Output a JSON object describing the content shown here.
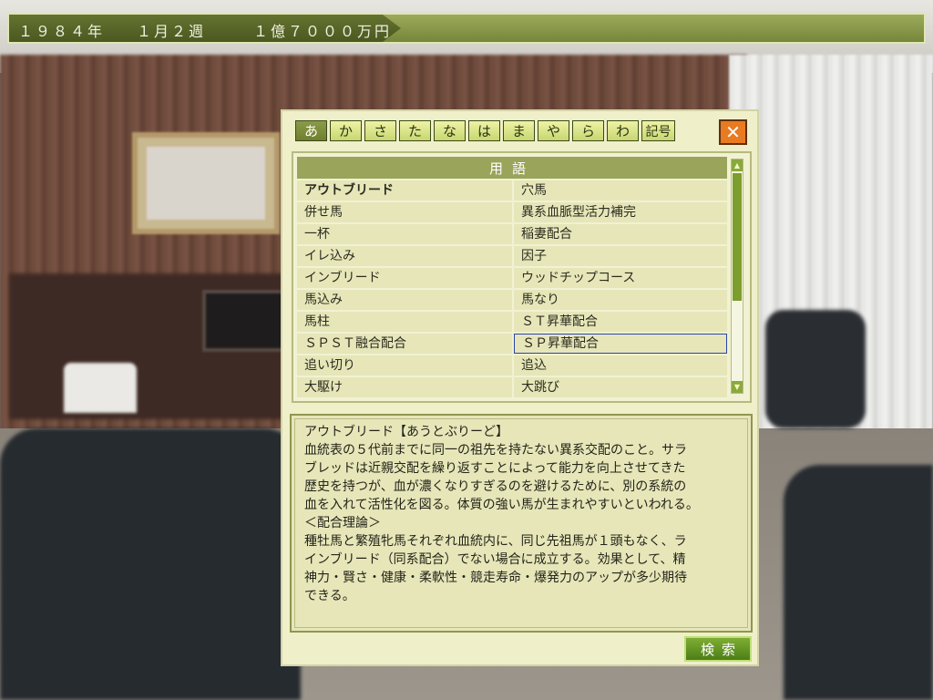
{
  "status_bar": {
    "year": "１９８４年",
    "week": "１月２週",
    "money": "１億７０００万円"
  },
  "tabs": [
    {
      "label": "あ",
      "active": true
    },
    {
      "label": "か",
      "active": false
    },
    {
      "label": "さ",
      "active": false
    },
    {
      "label": "た",
      "active": false
    },
    {
      "label": "な",
      "active": false
    },
    {
      "label": "は",
      "active": false
    },
    {
      "label": "ま",
      "active": false
    },
    {
      "label": "や",
      "active": false
    },
    {
      "label": "ら",
      "active": false
    },
    {
      "label": "わ",
      "active": false
    },
    {
      "label": "記号",
      "active": false
    }
  ],
  "close_icon": "close-icon",
  "list": {
    "header": "用語",
    "rows": [
      [
        "アウトブリード",
        "穴馬"
      ],
      [
        "併せ馬",
        "異系血脈型活力補完"
      ],
      [
        "一杯",
        "稲妻配合"
      ],
      [
        "イレ込み",
        "因子"
      ],
      [
        "インブリード",
        "ウッドチップコース"
      ],
      [
        "馬込み",
        "馬なり"
      ],
      [
        "馬柱",
        "ＳＴ昇華配合"
      ],
      [
        "ＳＰＳＴ融合配合",
        "ＳＰ昇華配合"
      ],
      [
        "追い切り",
        "追込"
      ],
      [
        "大駆け",
        "大跳び"
      ]
    ],
    "bold_term": "アウトブリード",
    "selected_term": "ＳＰ昇華配合"
  },
  "description": {
    "lines": [
      "アウトブリード【あうとぶりーど】",
      "血統表の５代前までに同一の祖先を持たない異系交配のこと。サラ",
      "ブレッドは近親交配を繰り返すことによって能力を向上させてきた",
      "歴史を持つが、血が濃くなりすぎるのを避けるために、別の系統の",
      "血を入れて活性化を図る。体質の強い馬が生まれやすいといわれる。",
      "＜配合理論＞",
      "種牡馬と繁殖牝馬それぞれ血統内に、同じ先祖馬が１頭もなく、ラ",
      "インブリード（同系配合）でない場合に成立する。効果として、精",
      "神力・賢さ・健康・柔軟性・競走寿命・爆発力のアップが多少期待",
      "できる。"
    ]
  },
  "search_button": "検索",
  "scrollbar": {
    "up_icon": "▲",
    "down_icon": "▼"
  },
  "colors": {
    "panel_bg": "#efefc9",
    "header_olive": "#9aa45a",
    "close_orange": "#e87a22",
    "search_green": "#5f931f"
  }
}
